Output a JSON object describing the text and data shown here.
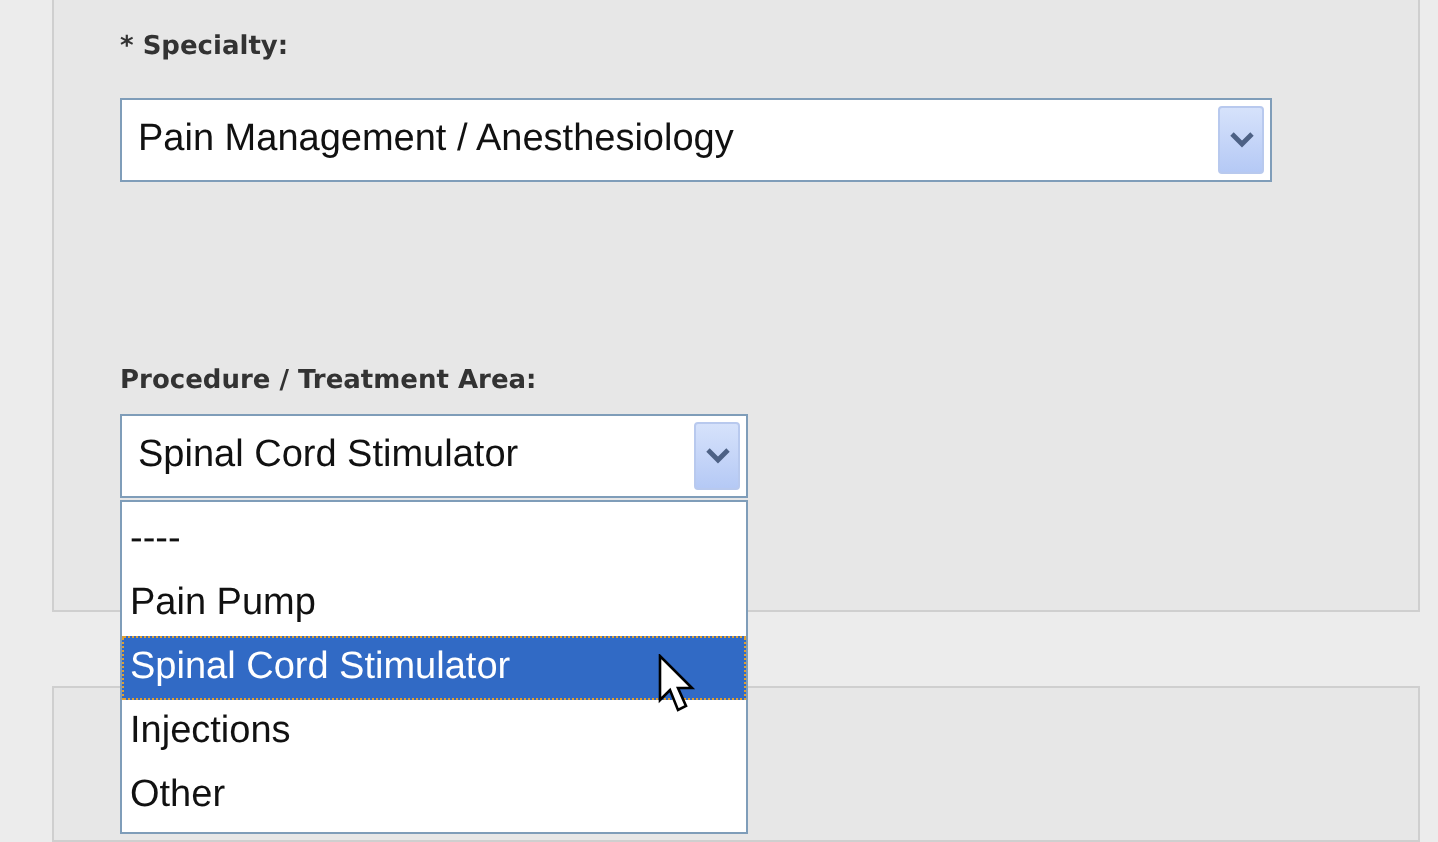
{
  "specialty": {
    "label": "* Specialty:",
    "value": "Pain Management / Anesthesiology"
  },
  "procedure": {
    "label": "Procedure / Treatment Area:",
    "value": "Spinal Cord Stimulator",
    "options": [
      {
        "label": "----",
        "selected": false
      },
      {
        "label": "Pain Pump",
        "selected": false
      },
      {
        "label": "Spinal Cord Stimulator",
        "selected": true
      },
      {
        "label": "Injections",
        "selected": false
      },
      {
        "label": "Other",
        "selected": false
      }
    ]
  }
}
